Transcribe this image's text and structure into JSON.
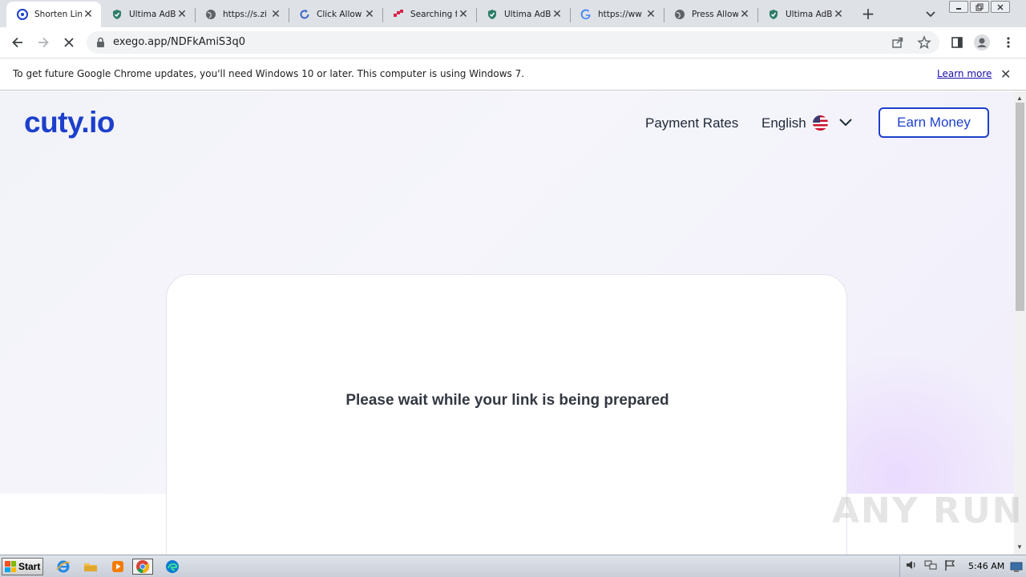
{
  "browser": {
    "tabs": [
      {
        "title": "Shorten Lin",
        "icon": "cuty-icon",
        "active": true
      },
      {
        "title": "Ultima AdBl",
        "icon": "shield-icon",
        "active": false
      },
      {
        "title": "https://s.zi",
        "icon": "globe-icon",
        "active": false
      },
      {
        "title": "Click Allow",
        "icon": "refresh-icon",
        "active": false
      },
      {
        "title": "Searching f",
        "icon": "dots-icon",
        "active": false
      },
      {
        "title": "Ultima AdBl",
        "icon": "shield-icon",
        "active": false
      },
      {
        "title": "https://ww",
        "icon": "google-icon",
        "active": false
      },
      {
        "title": "Press Allow",
        "icon": "globe-icon",
        "active": false
      },
      {
        "title": "Ultima AdBl",
        "icon": "shield-icon",
        "active": false
      }
    ],
    "new_tab_label": "+",
    "close_glyph": "✕",
    "url": "exego.app/NDFkAmiS3q0",
    "infobar": {
      "message": "To get future Google Chrome updates, you'll need Windows 10 or later. This computer is using Windows 7.",
      "link": "Learn more",
      "close": "✕"
    }
  },
  "site": {
    "logo": "cuty.io",
    "nav": {
      "payment_rates": "Payment Rates",
      "language": "English",
      "earn_money": "Earn Money"
    },
    "card": {
      "message": "Please wait while your link is being prepared"
    },
    "brand_color": "#1d3fcc"
  },
  "watermark": "ANY RUN",
  "taskbar": {
    "start_label": "Start",
    "apps": [
      "ie-icon",
      "explorer-icon",
      "media-player-icon",
      "chrome-icon",
      "edge-icon"
    ],
    "clock": "5:46 AM"
  }
}
